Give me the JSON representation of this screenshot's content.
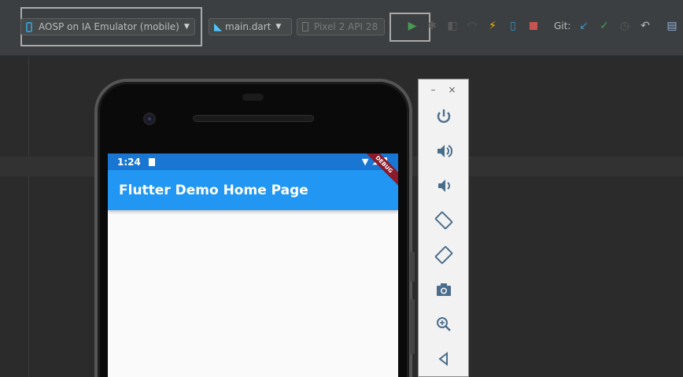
{
  "toolbar": {
    "device_selector": "AOSP on IA Emulator (mobile)",
    "config_selector": "main.dart",
    "avd_selector": "Pixel 2 API 28",
    "git_label": "Git:",
    "icons": [
      "phone-icon",
      "flutter-icon",
      "device-icon",
      "run-icon",
      "debug-icon",
      "coverage-icon",
      "profile-icon",
      "hot-reload-icon",
      "flutter-inspector-icon",
      "stop-icon",
      "git-update-icon",
      "git-commit-icon",
      "git-history-icon",
      "git-rollback-icon",
      "folder-icon"
    ]
  },
  "colors": {
    "ide_bg": "#2b2b2b",
    "toolbar_bg": "#3c3f41",
    "status_bar": "#1976d2",
    "app_bar": "#2196f3",
    "debug_banner": "#8b1a2b",
    "run_green": "#499c54",
    "stop_red": "#c75450",
    "lightning": "#f4b400"
  },
  "device": {
    "status_time": "1:24",
    "app_title": "Flutter Demo Home Page",
    "debug_banner": "DEBUG"
  },
  "emulator_controls": {
    "minimize": "–",
    "close": "×",
    "buttons": [
      "power-icon",
      "volume-up-icon",
      "volume-down-icon",
      "rotate-left-icon",
      "rotate-right-icon",
      "camera-icon",
      "zoom-icon",
      "back-icon"
    ]
  }
}
